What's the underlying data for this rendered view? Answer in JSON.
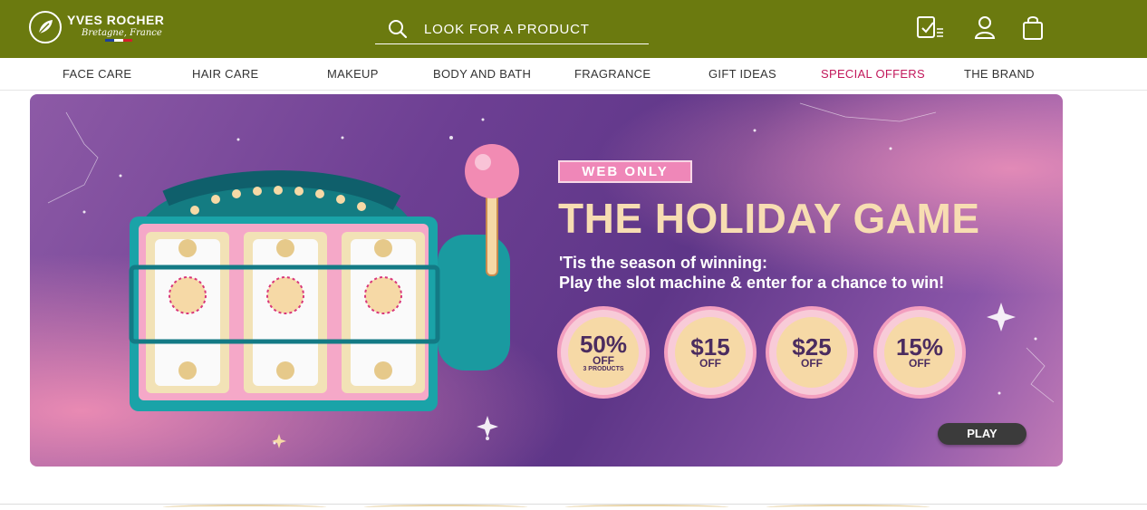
{
  "header": {
    "brand": "YVES ROCHER",
    "brand_sub": "Bretagne, France",
    "search_placeholder": "LOOK FOR A PRODUCT",
    "icons": [
      "order-tracking-icon",
      "user-icon",
      "shopping-bag-icon"
    ]
  },
  "nav": {
    "items": [
      {
        "label": "FACE CARE"
      },
      {
        "label": "HAIR CARE"
      },
      {
        "label": "MAKEUP"
      },
      {
        "label": "BODY AND BATH"
      },
      {
        "label": "FRAGRANCE"
      },
      {
        "label": "GIFT IDEAS"
      },
      {
        "label": "SPECIAL OFFERS",
        "color": "#c2185b"
      },
      {
        "label": "THE BRAND"
      }
    ]
  },
  "banner": {
    "badge": "WEB ONLY",
    "title": "THE HOLIDAY GAME",
    "subtitle_line1": "'Tis the season of winning:",
    "subtitle_line2": "Play the slot machine & enter for a chance to win!",
    "offers": [
      {
        "big": "50%",
        "small": "OFF",
        "tiny": "3 PRODUCTS"
      },
      {
        "big": "$15",
        "small": "OFF"
      },
      {
        "big": "$25",
        "small": "OFF"
      },
      {
        "big": "15%",
        "small": "OFF"
      }
    ],
    "play_label": "PLAY"
  },
  "colors": {
    "header_bg": "#6b7a0f",
    "accent_pink": "#ef87b8",
    "title_gold": "#f7ddb2",
    "special_offers": "#c2185b"
  }
}
